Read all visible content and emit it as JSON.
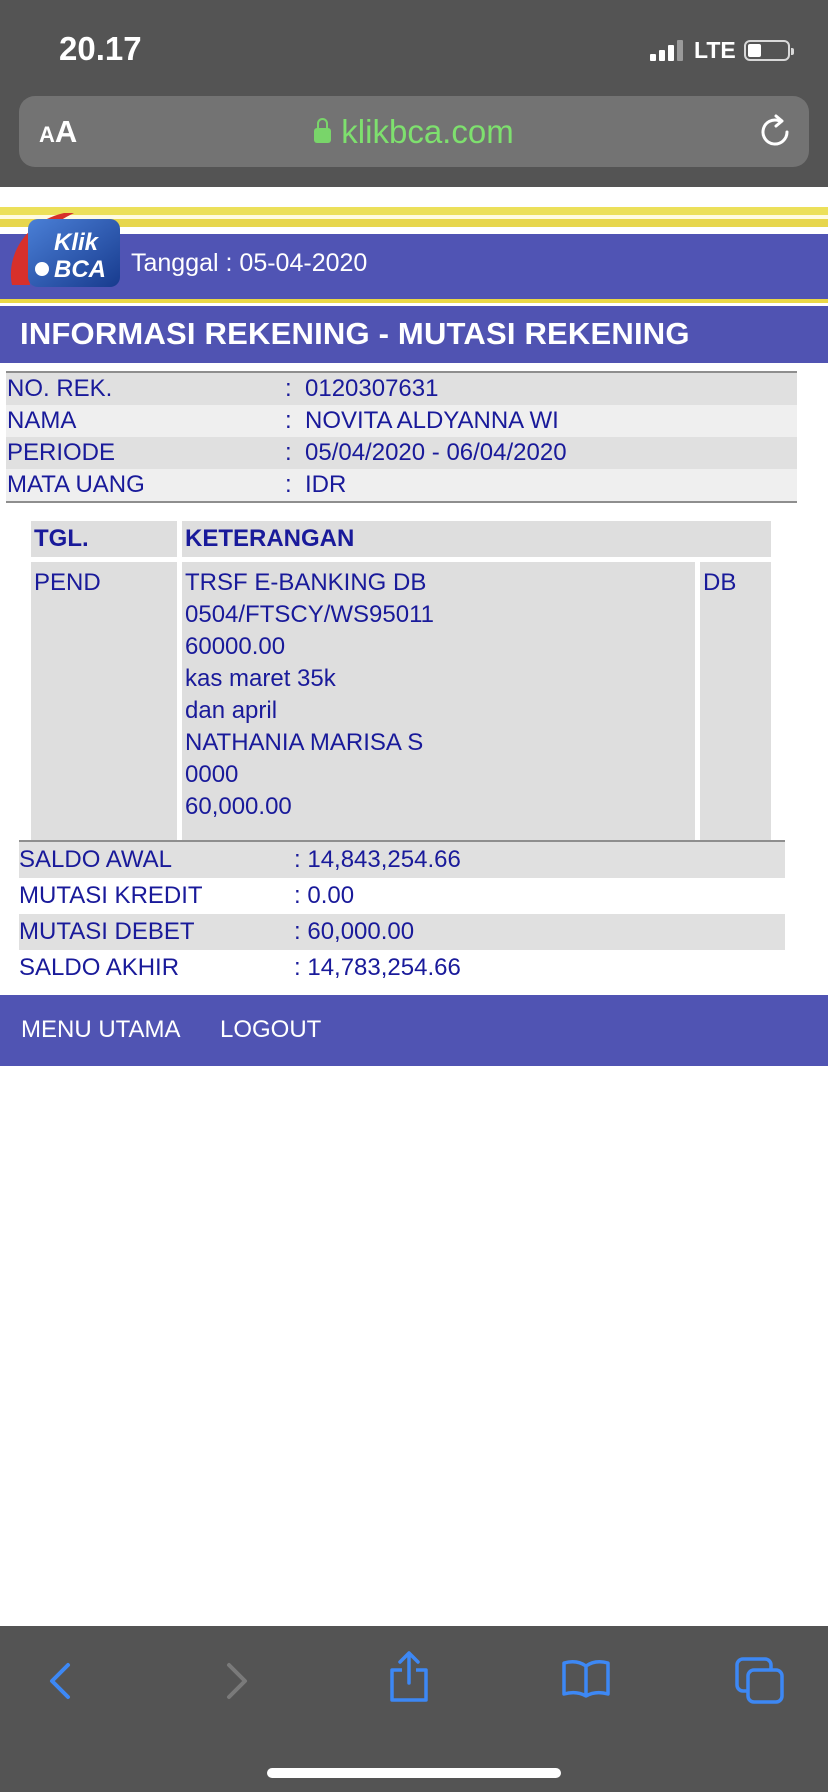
{
  "status_bar": {
    "time": "20.17",
    "network": "LTE"
  },
  "browser": {
    "text_size_small": "A",
    "text_size_big": "A",
    "url": "klikbca.com"
  },
  "header": {
    "logo_line1": "Klik",
    "logo_line2": "BCA",
    "date_label": "Tanggal",
    "date_value": "05-04-2020"
  },
  "page_title": "INFORMASI REKENING - MUTASI REKENING",
  "account": [
    {
      "label": "NO. REK.",
      "value": "0120307631"
    },
    {
      "label": "NAMA",
      "value": "NOVITA ALDYANNA WI"
    },
    {
      "label": "PERIODE",
      "value": "05/04/2020 - 06/04/2020"
    },
    {
      "label": "MATA UANG",
      "value": "IDR"
    }
  ],
  "transactions": {
    "headers": {
      "date": "TGL.",
      "description": "KETERANGAN"
    },
    "rows": [
      {
        "date": "PEND",
        "description": [
          "TRSF E-BANKING DB",
          "0504/FTSCY/WS95011",
          "60000.00",
          "kas maret 35k",
          "dan april",
          "NATHANIA MARISA S",
          "0000",
          "60,000.00"
        ],
        "type": "DB"
      }
    ]
  },
  "summary": [
    {
      "label": "SALDO AWAL",
      "value": "14,843,254.66"
    },
    {
      "label": "MUTASI KREDIT",
      "value": "0.00"
    },
    {
      "label": "MUTASI DEBET",
      "value": "60,000.00"
    },
    {
      "label": "SALDO AKHIR",
      "value": "14,783,254.66"
    }
  ],
  "footer": {
    "menu_utama": "MENU UTAMA",
    "logout": "LOGOUT"
  },
  "toolbar_icons": [
    "back-icon",
    "forward-icon",
    "share-icon",
    "bookmarks-icon",
    "tabs-icon"
  ],
  "colors": {
    "chrome": "#545454",
    "url_green": "#7ee06e",
    "bca_blue": "#5054b3",
    "text_navy": "#191a9a",
    "yellow": "#ece05a",
    "ios_blue": "#3d88f5"
  }
}
